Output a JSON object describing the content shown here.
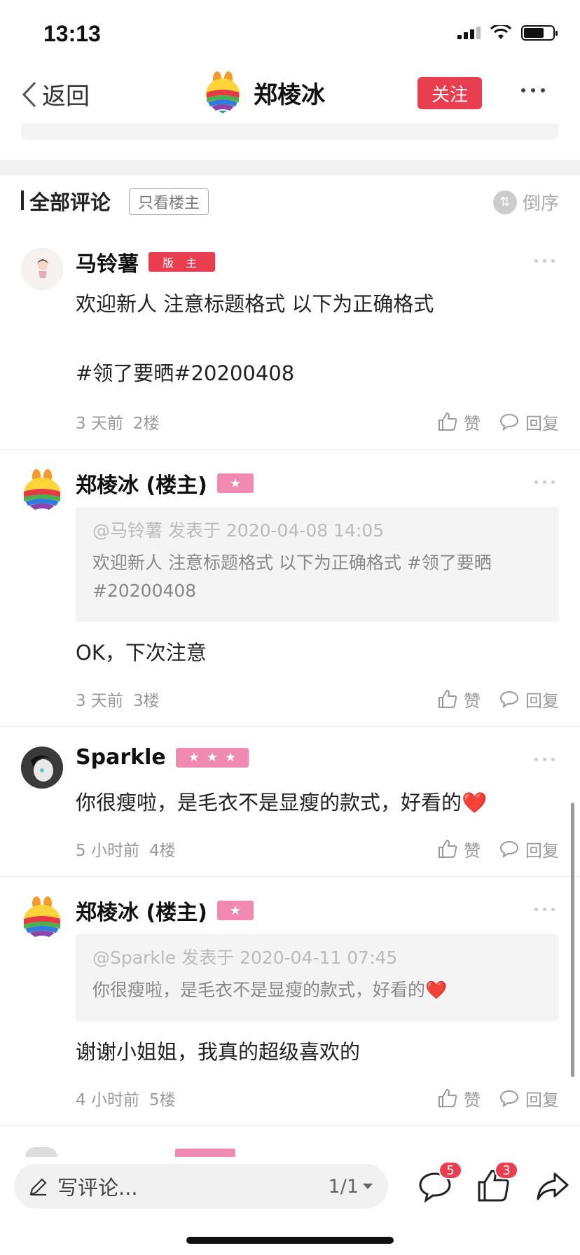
{
  "status": {
    "time": "13:13"
  },
  "nav": {
    "back_label": "返回",
    "title": "郑棱冰",
    "follow_label": "关注"
  },
  "comments_header": {
    "title": "全部评论",
    "owner_only": "只看楼主",
    "sort_label": "倒序"
  },
  "actions": {
    "like_label": "赞",
    "reply_label": "回复"
  },
  "comments": [
    {
      "name": "马铃薯",
      "badge": "版 主",
      "text_line1": "欢迎新人 注意标题格式 以下为正确格式",
      "text_line2": "#领了要晒#20200408",
      "time": "3 天前",
      "floor": "2楼"
    },
    {
      "name": "郑棱冰 (楼主)",
      "stars": 1,
      "quote_meta": "@马铃薯 发表于 2020-04-08 14:05",
      "quote_text": "欢迎新人 注意标题格式 以下为正确格式 #领了要晒#20200408",
      "text": "OK，下次注意",
      "time": "3 天前",
      "floor": "3楼"
    },
    {
      "name": "Sparkle",
      "stars": 3,
      "text": "你很瘦啦，是毛衣不是显瘦的款式，好看的❤️",
      "time": "5 小时前",
      "floor": "4楼"
    },
    {
      "name": "郑棱冰 (楼主)",
      "stars": 1,
      "quote_meta": "@Sparkle 发表于 2020-04-11 07:45",
      "quote_text": "你很瘦啦，是毛衣不是显瘦的款式，好看的❤️",
      "text": "谢谢小姐姐，我真的超级喜欢的",
      "time": "4 小时前",
      "floor": "5楼"
    }
  ],
  "bottom_bar": {
    "placeholder": "写评论...",
    "page": "1/1",
    "comment_count": "5",
    "like_count": "3"
  },
  "colors": {
    "accent": "#e83e50",
    "star_badge": "#f08ab0"
  }
}
